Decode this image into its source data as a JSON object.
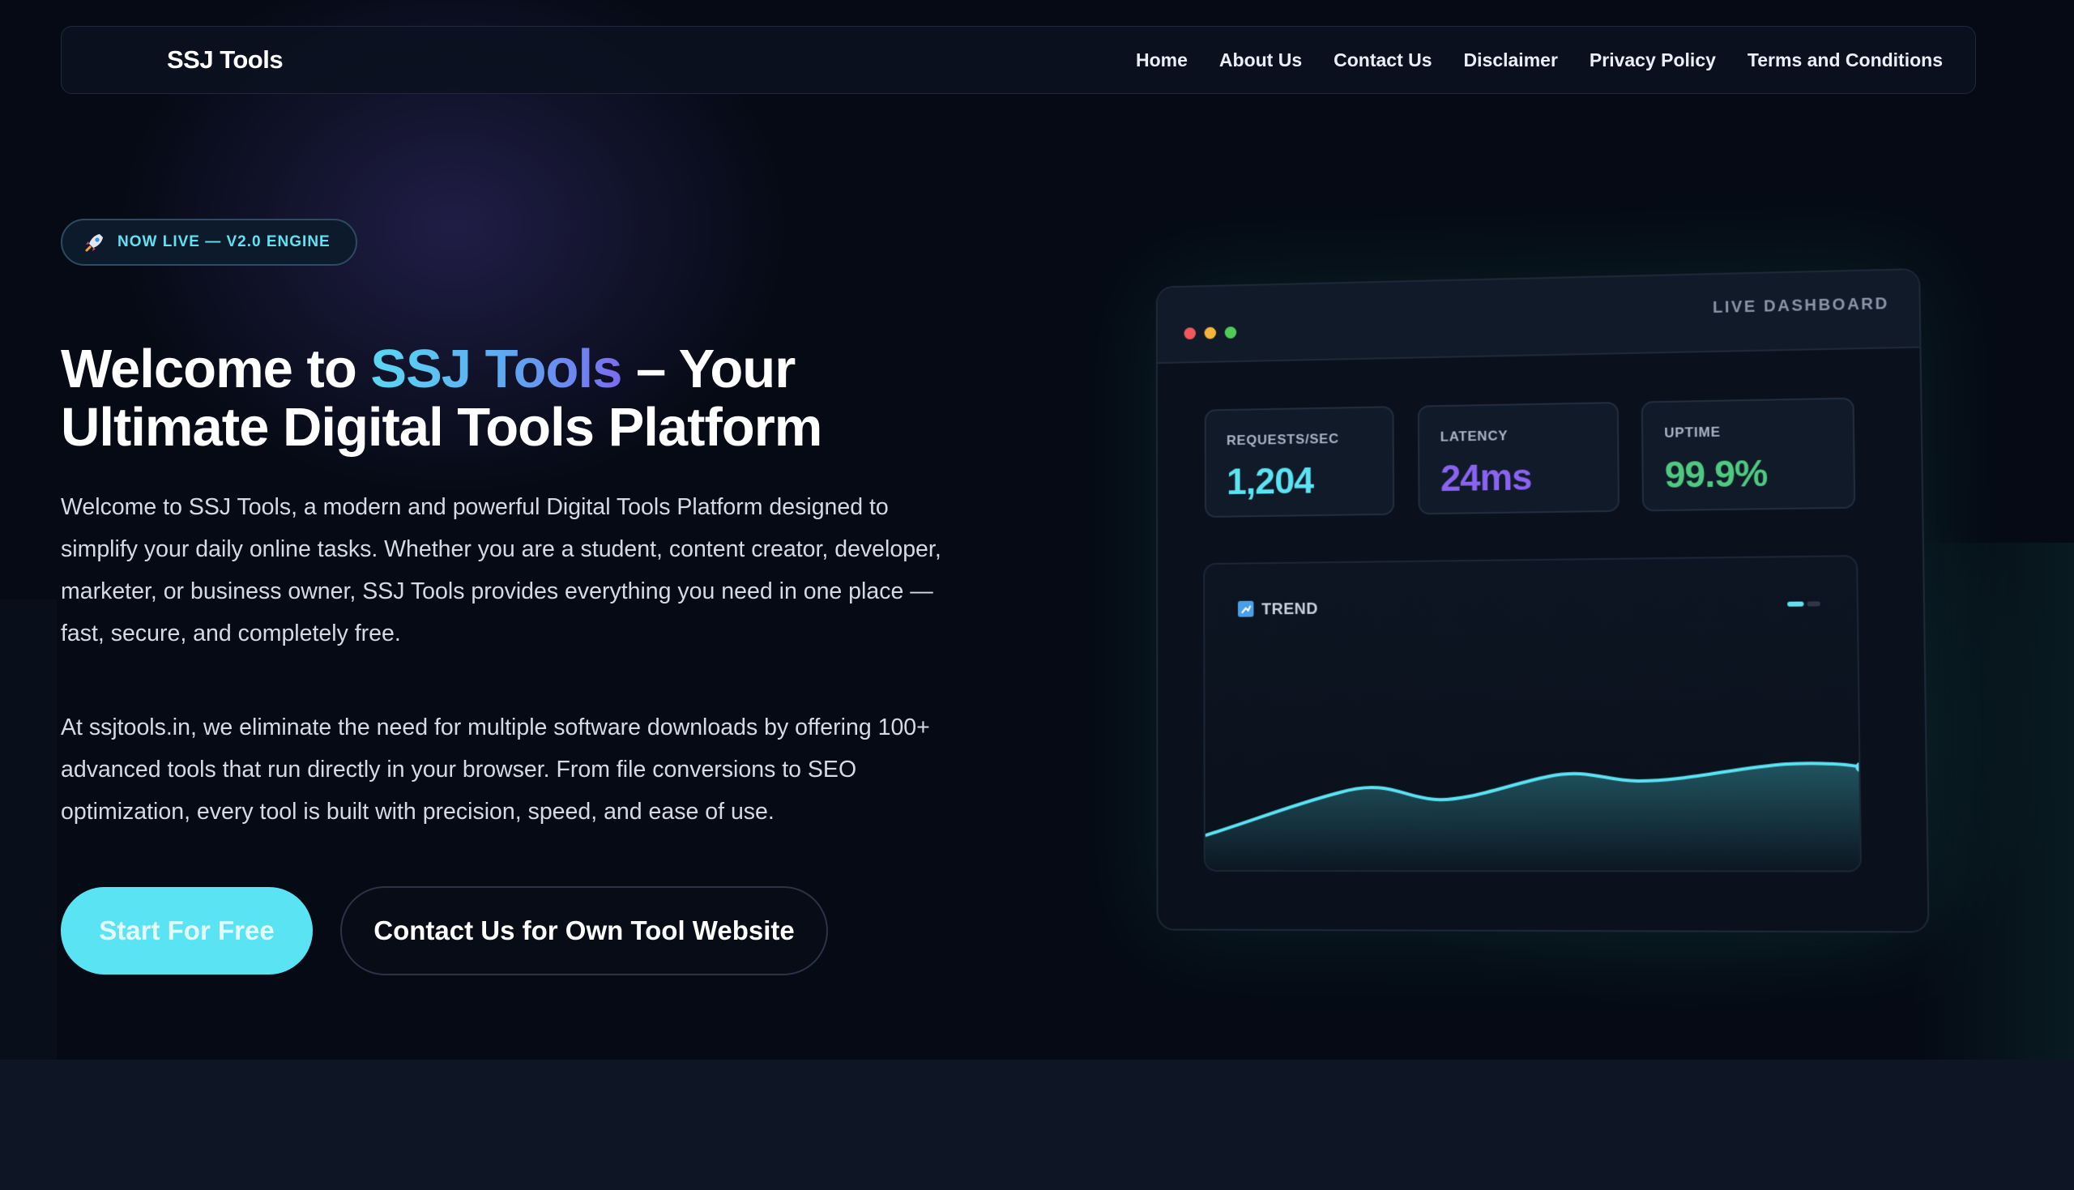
{
  "nav": {
    "brand": "SSJ Tools",
    "links": [
      "Home",
      "About Us",
      "Contact Us",
      "Disclaimer",
      "Privacy Policy",
      "Terms and Conditions"
    ]
  },
  "badge": {
    "icon": "rocket-icon",
    "text": "NOW LIVE — V2.0 ENGINE"
  },
  "hero": {
    "title_prefix": "Welcome to ",
    "title_accent": "SSJ Tools",
    "title_line1_suffix": " – Your",
    "title_line2": "Ultimate Digital Tools Platform",
    "paragraph1": "Welcome to SSJ Tools, a modern and powerful Digital Tools Platform designed to simplify your daily online tasks. Whether you are a student, content creator, developer, marketer, or business owner, SSJ Tools provides everything you need in one place — fast, secure, and completely free.",
    "paragraph2": "At ssjtools.in, we eliminate the need for multiple software downloads by offering 100+ advanced tools that run directly in your browser. From file conversions to SEO optimization, every tool is built with precision, speed, and ease of use.",
    "primary_button": "Start For Free",
    "secondary_button": "Contact Us for Own Tool Website"
  },
  "dashboard": {
    "title": "LIVE DASHBOARD",
    "stats": [
      {
        "label": "REQUESTS/SEC",
        "value": "1,204",
        "color": "#5ae3f2"
      },
      {
        "label": "LATENCY",
        "value": "24ms",
        "color": "#8a63f0"
      },
      {
        "label": "UPTIME",
        "value": "99.9%",
        "color": "#4fc981"
      }
    ],
    "trend_label": "TREND",
    "trend_icon": "chart-trend-icon"
  },
  "colors": {
    "accent_cyan": "#5ae3f2",
    "accent_purple": "#7b6cf0",
    "background": "#050a14"
  }
}
